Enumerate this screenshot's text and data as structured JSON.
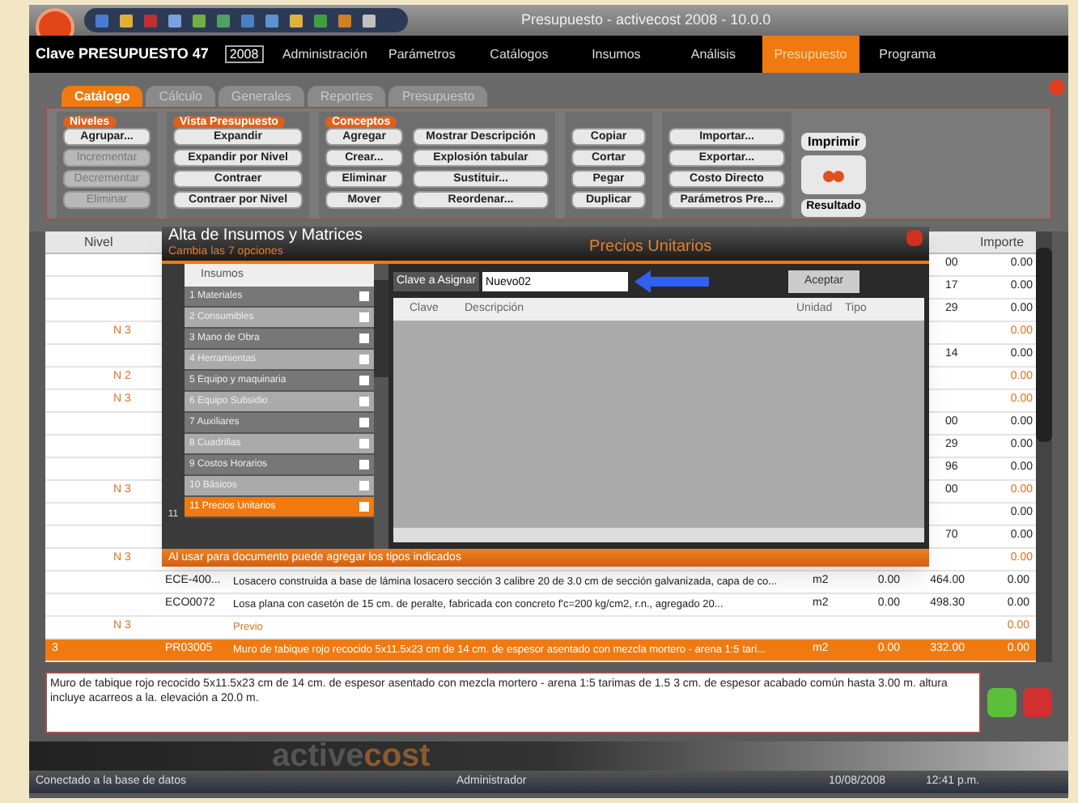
{
  "window": {
    "title": "Presupuesto - activecost 2008 - 10.0.0"
  },
  "header": {
    "clave_label": "Clave PRESUPUESTO 47",
    "year": "2008"
  },
  "menu": [
    {
      "label": "Administración",
      "selected": false
    },
    {
      "label": "Parámetros",
      "selected": false
    },
    {
      "label": "Catálogos",
      "selected": false
    },
    {
      "label": "Insumos",
      "selected": false
    },
    {
      "label": "Análisis",
      "selected": false
    },
    {
      "label": "Presupuesto",
      "selected": true
    },
    {
      "label": "Programa",
      "selected": false
    }
  ],
  "tabs": [
    {
      "label": "Catálogo",
      "selected": true
    },
    {
      "label": "Cálculo",
      "selected": false
    },
    {
      "label": "Generales",
      "selected": false
    },
    {
      "label": "Reportes",
      "selected": false
    },
    {
      "label": "Presupuesto",
      "selected": false
    }
  ],
  "ribbon_groups": [
    {
      "title": "Niveles",
      "columns": [
        [
          {
            "label": "Agrupar...",
            "disabled": false
          },
          {
            "label": "Incrementar",
            "disabled": true
          },
          {
            "label": "Decrementar",
            "disabled": true
          },
          {
            "label": "Eliminar",
            "disabled": true
          }
        ]
      ]
    },
    {
      "title": "Vista Presupuesto",
      "columns": [
        [
          {
            "label": "Expandir",
            "disabled": false
          },
          {
            "label": "Expandir por Nivel",
            "disabled": false
          },
          {
            "label": "Contraer",
            "disabled": false
          },
          {
            "label": "Contraer por Nivel",
            "disabled": false
          }
        ]
      ]
    },
    {
      "title": "Conceptos",
      "columns": [
        [
          {
            "label": "Agregar",
            "disabled": false
          },
          {
            "label": "Crear...",
            "disabled": false
          },
          {
            "label": "Eliminar",
            "disabled": false
          },
          {
            "label": "Mover",
            "disabled": false
          }
        ],
        [
          {
            "label": "Mostrar Descripción",
            "disabled": false
          },
          {
            "label": "Explosión tabular",
            "disabled": false
          },
          {
            "label": "Sustituir...",
            "disabled": false
          },
          {
            "label": "Reordenar...",
            "disabled": false
          }
        ]
      ]
    },
    {
      "columns": [
        [
          {
            "label": "Copiar",
            "disabled": false
          },
          {
            "label": "Cortar",
            "disabled": false
          },
          {
            "label": "Pegar",
            "disabled": false
          },
          {
            "label": "Duplicar",
            "disabled": false
          }
        ]
      ]
    },
    {
      "columns": [
        [
          {
            "label": "Importar...",
            "disabled": false
          },
          {
            "label": "Exportar...",
            "disabled": false
          },
          {
            "label": "Costo Directo",
            "disabled": false
          },
          {
            "label": "Parámetros Pre...",
            "disabled": false
          }
        ]
      ]
    }
  ],
  "ribbon_side": {
    "print": "Imprimir",
    "result": "Resultado"
  },
  "grid": {
    "columns": {
      "nivel": "Nivel",
      "importe": "Importe"
    },
    "rows": [
      {
        "kind": "covered",
        "nivel": "",
        "partial": "00",
        "importe": "0.00",
        "orange": false
      },
      {
        "kind": "covered",
        "nivel": "",
        "partial": "17",
        "importe": "0.00",
        "orange": false
      },
      {
        "kind": "covered",
        "nivel": "",
        "partial": "29",
        "importe": "0.00",
        "orange": false
      },
      {
        "kind": "covered",
        "nivel": "N 3",
        "partial": "",
        "importe": "0.00",
        "orange": true
      },
      {
        "kind": "covered",
        "nivel": "",
        "partial": "14",
        "importe": "0.00",
        "orange": false
      },
      {
        "kind": "covered",
        "nivel": "N 2",
        "partial": "",
        "importe": "0.00",
        "orange": true
      },
      {
        "kind": "covered",
        "nivel": "N 3",
        "partial": "",
        "importe": "0.00",
        "orange": true
      },
      {
        "kind": "covered",
        "nivel": "",
        "partial": "00",
        "importe": "0.00",
        "orange": false
      },
      {
        "kind": "covered",
        "nivel": "",
        "partial": "29",
        "importe": "0.00",
        "orange": false
      },
      {
        "kind": "covered",
        "nivel": "",
        "partial": "96",
        "importe": "0.00",
        "orange": false
      },
      {
        "kind": "covered",
        "nivel": "N 3",
        "partial": "00",
        "importe": "0.00",
        "orange": true
      },
      {
        "kind": "covered",
        "nivel": "",
        "partial": "",
        "importe": "0.00",
        "orange": false
      },
      {
        "kind": "covered",
        "nivel": "",
        "partial": "70",
        "importe": "0.00",
        "orange": false
      },
      {
        "kind": "covered",
        "nivel": "N 3",
        "partial": "",
        "importe": "0.00",
        "orange": true
      },
      {
        "kind": "full",
        "selected": false,
        "nivel": "",
        "clave": "ECE-400...",
        "descripcion": "Losacero construida a base de lámina losacero sección 3 calibre 20 de 3.0 cm de sección galvanizada, capa de co...",
        "unidad": "m2",
        "cantidad": "0.00",
        "precio": "464.00",
        "importe": "0.00",
        "orange": false
      },
      {
        "kind": "full",
        "selected": false,
        "nivel": "",
        "clave": "ECO0072",
        "descripcion": "Losa plana con casetón de 15 cm. de peralte, fabricada con concreto f'c=200 kg/cm2, r.n., agregado 20...",
        "unidad": "m2",
        "cantidad": "0.00",
        "precio": "498.30",
        "importe": "0.00",
        "orange": false
      },
      {
        "kind": "full",
        "selected": false,
        "nivel": "N 3",
        "clave": "",
        "descripcion": "Previo",
        "unidad": "",
        "cantidad": "",
        "precio": "",
        "importe": "0.00",
        "orange": true
      },
      {
        "kind": "full",
        "selected": true,
        "row_number": "3",
        "nivel": "",
        "clave": "PR03005",
        "descripcion": "Muro de tabique rojo recocido 5x11.5x23 cm de 14 cm. de espesor asentado con mezcla mortero - arena 1:5 tari...",
        "unidad": "m2",
        "cantidad": "0.00",
        "precio": "332.00",
        "importe": "0.00",
        "orange": false
      }
    ]
  },
  "dialog": {
    "title": "Alta de Insumos y Matrices",
    "subtitle": "Cambia las 7 opciones",
    "section": "Precios Unitarios",
    "list_header": "Insumos",
    "items": [
      {
        "number": "1",
        "label": "Materiales",
        "selected": false
      },
      {
        "number": "2",
        "label": "Consumibles",
        "selected": false
      },
      {
        "number": "3",
        "label": "Mano de Obra",
        "selected": false
      },
      {
        "number": "4",
        "label": "Herramientas",
        "selected": false
      },
      {
        "number": "5",
        "label": "Equipo y maquinaria",
        "selected": false
      },
      {
        "number": "6",
        "label": "Equipo Subsidio",
        "selected": false
      },
      {
        "number": "7",
        "label": "Auxiliares",
        "selected": false
      },
      {
        "number": "8",
        "label": "Cuadrillas",
        "selected": false
      },
      {
        "number": "9",
        "label": "Costos Horarios",
        "selected": false
      },
      {
        "number": "10",
        "label": "Básicos",
        "selected": false
      },
      {
        "number": "11",
        "label": "Precios Unitarios",
        "selected": true
      }
    ],
    "current_row_number": "11",
    "key_label": "Clave a Asignar",
    "key_value": "Nuevo02",
    "accept": "Aceptar",
    "columns": [
      "Clave",
      "Descripción",
      "Unidad",
      "Tipo"
    ],
    "hint": "Al usar para documento puede agregar los tipos indicados"
  },
  "description": "Muro de tabique rojo recocido 5x11.5x23 cm de 14 cm. de espesor asentado con mezcla mortero - arena 1:5 tarimas de 1.5 3 cm. de espesor acabado común hasta 3.00 m. altura incluye acarreos a la. elevación a 20.0 m.",
  "logo": {
    "part1": "active",
    "part2": "cost"
  },
  "status_bar": {
    "connection": "Conectado a la base de datos",
    "user": "Administrador",
    "date": "10/08/2008",
    "time": "12:41 p.m."
  }
}
